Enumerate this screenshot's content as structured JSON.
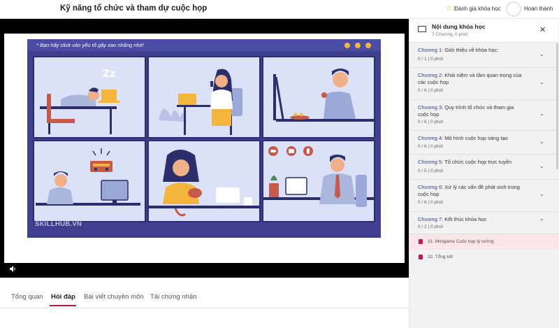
{
  "header": {
    "course_title": "Kỹ năng tổ chức và tham dự cuộc họp",
    "rate_label": "Đánh giá khóa học",
    "done_label": "Hoàn thành"
  },
  "video": {
    "slide_note": "* Bạn hãy click vào yếu tố gây xao nhãng nhé!",
    "watermark": "SKILLHUB.VN",
    "volume_icon": "volume-icon"
  },
  "tabs": [
    {
      "label": "Tổng quan"
    },
    {
      "label": "Hỏi đáp"
    },
    {
      "label": "Bài viết chuyên môn"
    },
    {
      "label": "Tải chứng nhận"
    }
  ],
  "sidebar": {
    "title": "Nội dung khóa học",
    "subtitle": "7 Chương, 0 phút",
    "chapters": [
      {
        "num": "Chương 1:",
        "title": " Giới thiệu về khóa học:",
        "meta": "0 / 1  |  0 phút"
      },
      {
        "num": "Chương 2:",
        "title": " Khái niệm và tầm quan trọng của các cuộc họp",
        "meta": "0 / 6  |  0 phút"
      },
      {
        "num": "Chương 3:",
        "title": " Quy trình tổ chức và tham gia cuộc họp",
        "meta": "0 / 6  |  0 phút"
      },
      {
        "num": "Chương 4:",
        "title": " Mô hình cuộc họp sáng tạo",
        "meta": "0 / 6  |  0 phút"
      },
      {
        "num": "Chương 5:",
        "title": " Tổ chức cuộc họp trực tuyến",
        "meta": "0 / 5  |  0 phút"
      },
      {
        "num": "Chương 6:",
        "title": " Xử lý các vấn đề phát sinh trong cuộc họp",
        "meta": "0 / 6  |  0 phút"
      },
      {
        "num": "Chương 7:",
        "title": " Kết thúc khóa học",
        "meta": "0 / 2  |  0 phút"
      }
    ],
    "lessons": [
      {
        "label": "31. Minigame Cuộc họp lý tưởng"
      },
      {
        "label": "32. Tổng kết"
      }
    ]
  },
  "colors": {
    "accent": "#b0154b",
    "slide_bg": "#3e3f8f",
    "panel_bg": "#dbe1f6",
    "chapter_link": "#2a3f8a"
  }
}
